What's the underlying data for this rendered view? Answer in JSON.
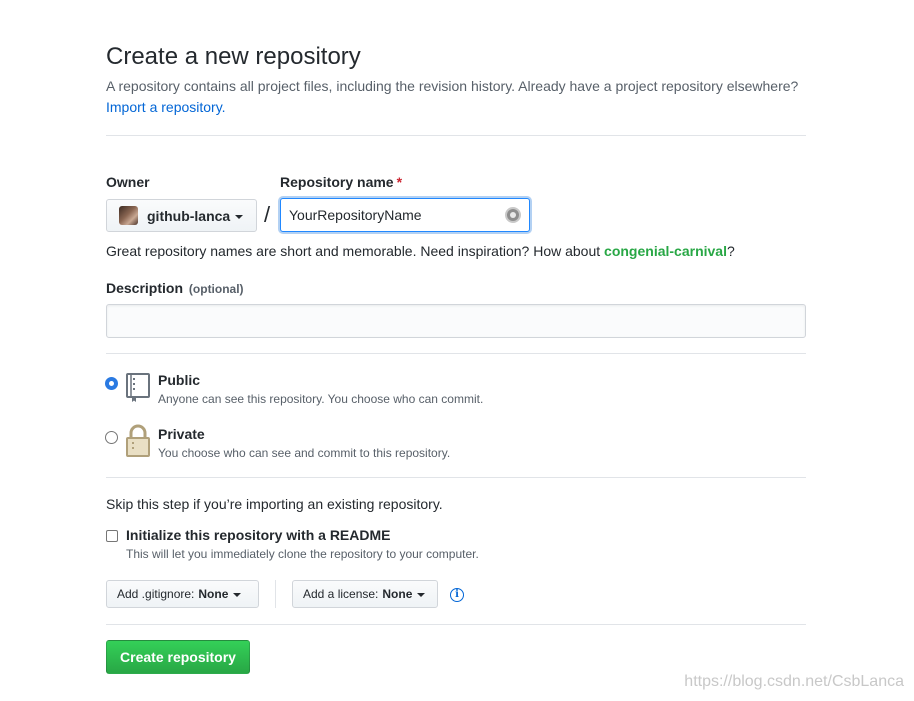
{
  "header": {
    "title": "Create a new repository",
    "subhead_text": "A repository contains all project files, including the revision history. Already have a project repository elsewhere?",
    "import_link": "Import a repository."
  },
  "owner": {
    "label": "Owner",
    "value": "github-lanca",
    "separator": "/"
  },
  "repo_name": {
    "label": "Repository name",
    "required_mark": "*",
    "value": "YourRepositoryName"
  },
  "name_hint": {
    "text_before": "Great repository names are short and memorable. Need inspiration? How about",
    "suggestion": "congenial-carnival",
    "text_after": "?"
  },
  "description": {
    "label": "Description",
    "optional": "(optional)",
    "value": ""
  },
  "visibility": {
    "selected": "public",
    "public": {
      "title": "Public",
      "note": "Anyone can see this repository. You choose who can commit."
    },
    "private": {
      "title": "Private",
      "note": "You choose who can see and commit to this repository."
    }
  },
  "init": {
    "skip_text": "Skip this step if you’re importing an existing repository.",
    "readme_label": "Initialize this repository with a README",
    "readme_note": "This will let you immediately clone the repository to your computer.",
    "readme_checked": false
  },
  "selects": {
    "gitignore_label": "Add .gitignore:",
    "gitignore_value": "None",
    "license_label": "Add a license:",
    "license_value": "None",
    "info_glyph": "i"
  },
  "submit": {
    "label": "Create repository"
  },
  "watermark": "https://blog.csdn.net/CsbLanca",
  "colors": {
    "link": "#0366d6",
    "suggestion": "#28a745",
    "required": "#cb2431",
    "primary_button": "#2ea44f",
    "radio_checked": "#2a7ae2"
  }
}
